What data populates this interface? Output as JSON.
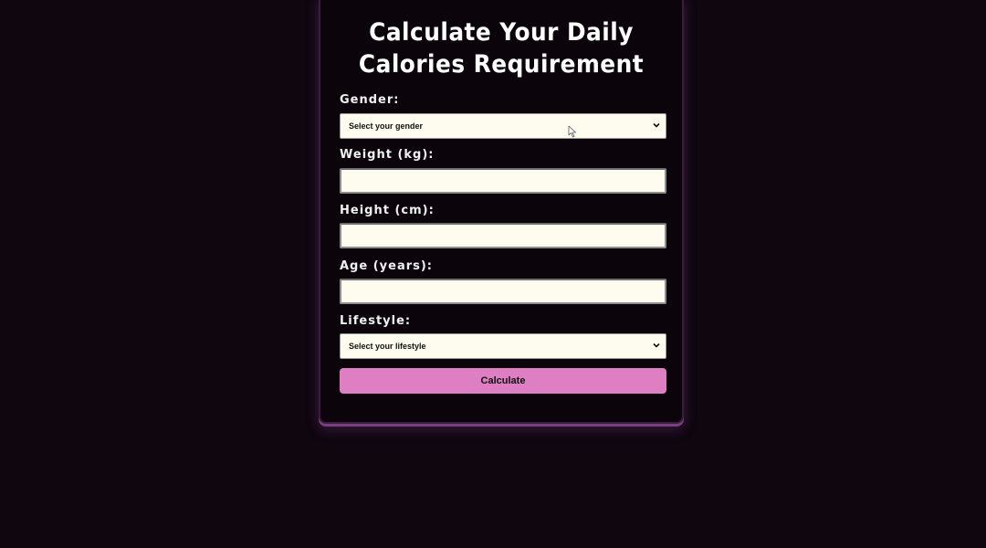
{
  "form": {
    "title_line1": "Calculate Your Daily",
    "title_line2": "Calories Requirement",
    "gender": {
      "label": "Gender:",
      "selected": "Select your gender"
    },
    "weight": {
      "label": "Weight (kg):",
      "value": ""
    },
    "height": {
      "label": "Height (cm):",
      "value": ""
    },
    "age": {
      "label": "Age (years):",
      "value": ""
    },
    "lifestyle": {
      "label": "Lifestyle:",
      "selected": "Select your lifestyle"
    },
    "button_label": "Calculate"
  },
  "colors": {
    "background": "#0f0610",
    "card": "#0b040b",
    "field": "#fdfcee",
    "button": "#de7fc3",
    "card_shadow": "#7a3f7f"
  },
  "icons": {
    "select_arrow": "chevron-down-icon",
    "pointer": "mouse-cursor-icon"
  }
}
